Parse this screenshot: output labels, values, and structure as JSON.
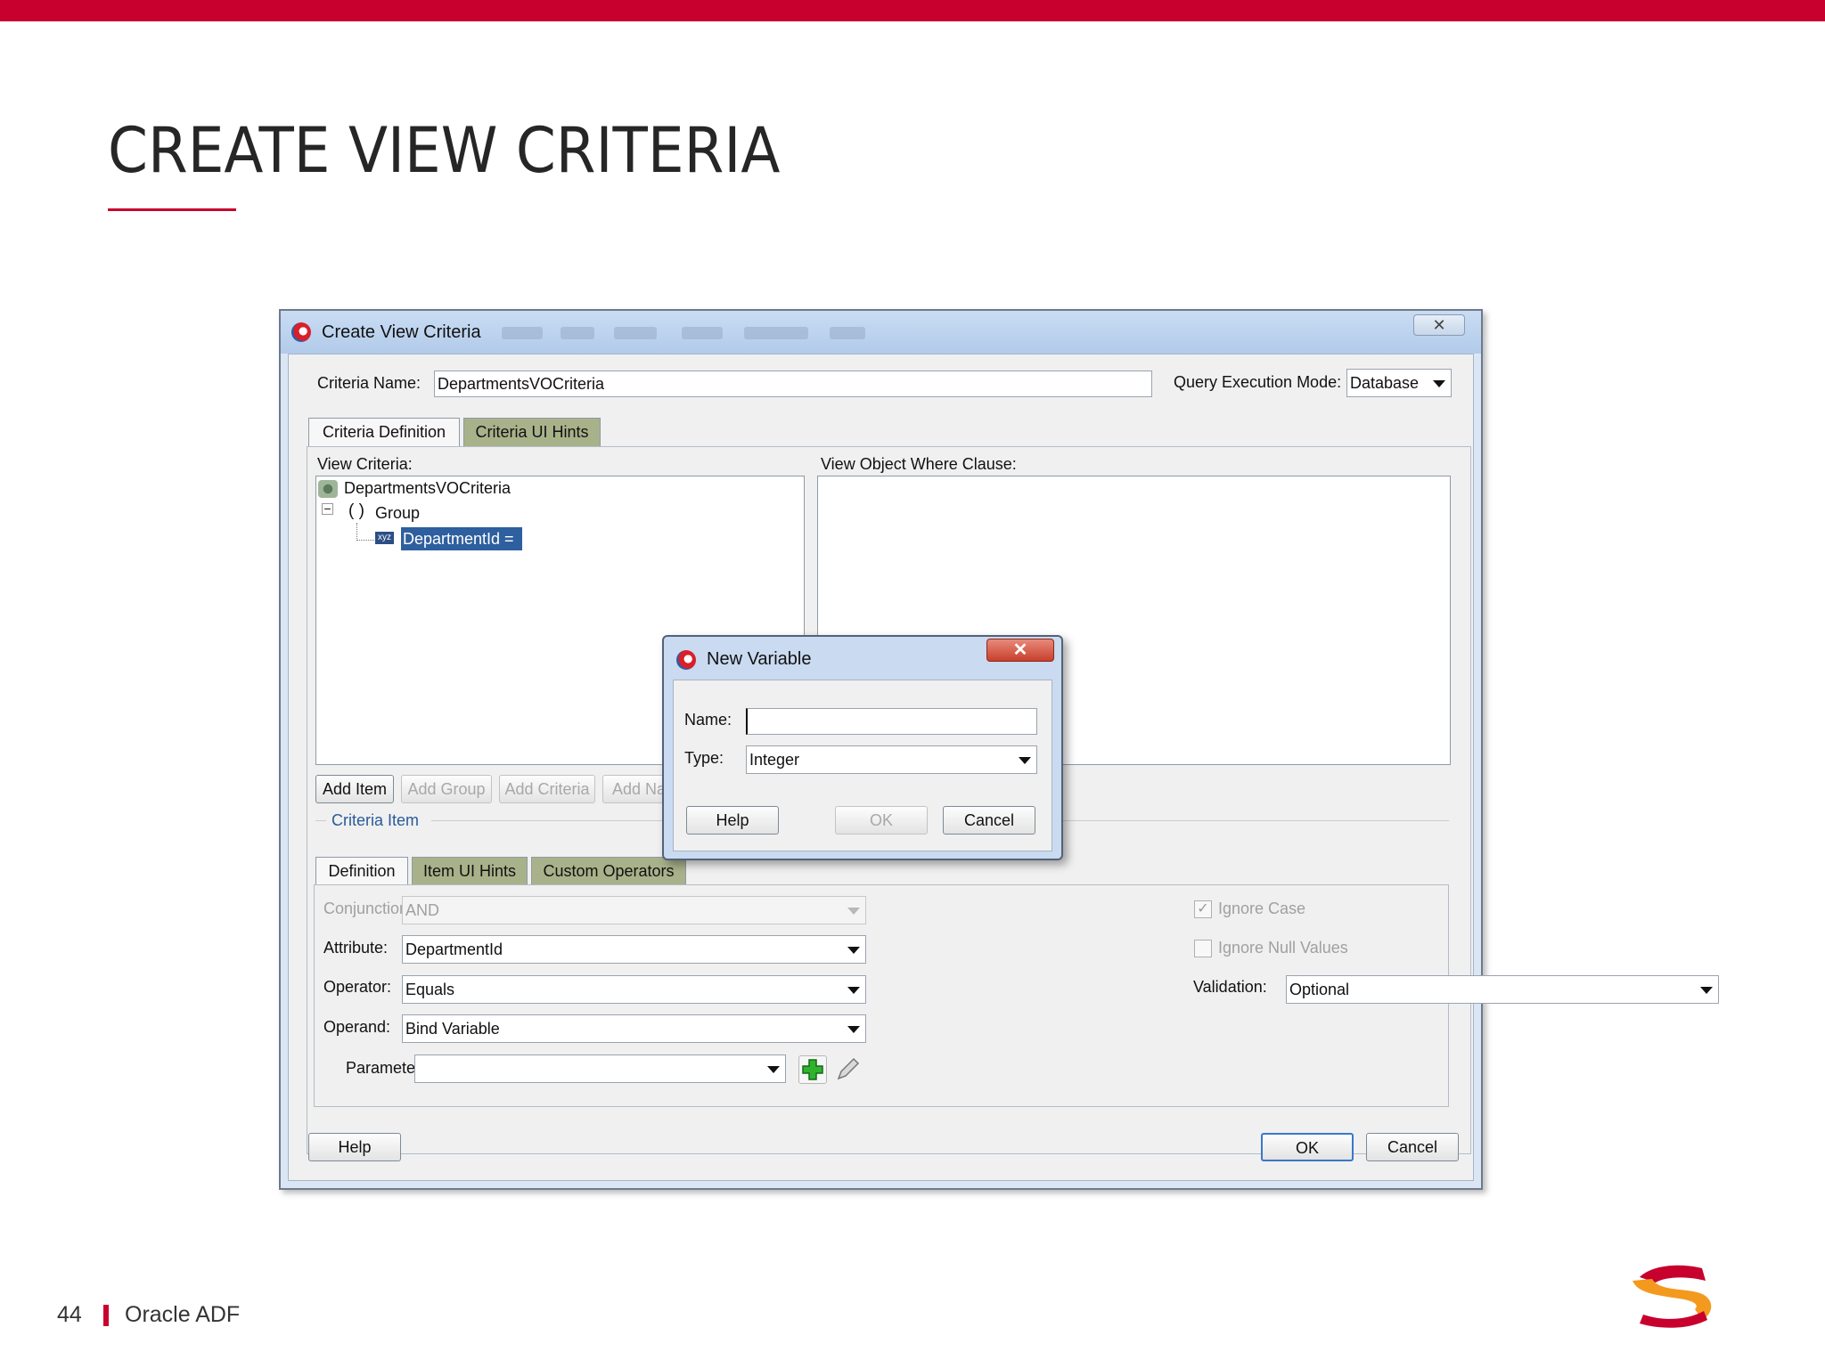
{
  "slide": {
    "title": "CREATE VIEW CRITERIA",
    "page_number": "44",
    "footer_label": "Oracle ADF",
    "accent_color": "#c8002e"
  },
  "window": {
    "title": "Create View Criteria",
    "close_glyph": "✕",
    "criteria_name_label": "Criteria Name:",
    "criteria_name_value": "DepartmentsVOCriteria",
    "query_mode_label": "Query Execution Mode:",
    "query_mode_value": "Database",
    "tabs": [
      {
        "label": "Criteria Definition"
      },
      {
        "label": "Criteria UI Hints"
      }
    ],
    "view_criteria_label": "View Criteria:",
    "where_clause_label": "View Object Where Clause:",
    "tree": {
      "root": "DepartmentsVOCriteria",
      "group_glyph": "( )",
      "group": "Group",
      "item_tag": "xyz",
      "item": "DepartmentId ="
    },
    "tree_buttons": [
      {
        "label": "Add Item"
      },
      {
        "label": "Add Group"
      },
      {
        "label": "Add Criteria"
      },
      {
        "label": "Add Na"
      }
    ],
    "criteria_item_label": "Criteria Item",
    "item_tabs": [
      {
        "label": "Definition"
      },
      {
        "label": "Item UI Hints"
      },
      {
        "label": "Custom Operators"
      }
    ],
    "conjunction_label": "Conjunction:",
    "conjunction_value": "AND",
    "attribute_label": "Attribute:",
    "attribute_value": "DepartmentId",
    "operator_label": "Operator:",
    "operator_value": "Equals",
    "operand_label": "Operand:",
    "operand_value": "Bind Variable",
    "parameter_label": "Parameter:",
    "parameter_value": "",
    "ignore_case_label": "Ignore Case",
    "ignore_null_label": "Ignore Null Values",
    "validation_label": "Validation:",
    "validation_value": "Optional",
    "help_button": "Help",
    "ok_button": "OK",
    "cancel_button": "Cancel"
  },
  "dialog": {
    "title": "New Variable",
    "close_glyph": "✕",
    "name_label": "Name:",
    "name_value": "",
    "type_label": "Type:",
    "type_value": "Integer",
    "help_button": "Help",
    "ok_button": "OK",
    "cancel_button": "Cancel"
  }
}
